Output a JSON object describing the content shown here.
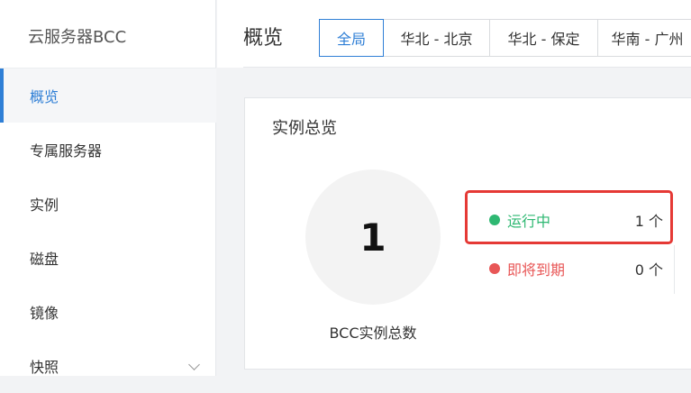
{
  "sidebar": {
    "title": "云服务器BCC",
    "items": [
      {
        "label": "概览",
        "active": true
      },
      {
        "label": "专属服务器"
      },
      {
        "label": "实例"
      },
      {
        "label": "磁盘"
      },
      {
        "label": "镜像"
      },
      {
        "label": "快照",
        "has_chevron": true
      }
    ]
  },
  "header": {
    "title": "概览",
    "region_tabs": [
      {
        "label": "全局",
        "active": true
      },
      {
        "label": "华北 - 北京"
      },
      {
        "label": "华北 - 保定"
      },
      {
        "label": "华南 - 广州"
      }
    ]
  },
  "overview_card": {
    "title": "实例总览",
    "total_count": "1",
    "total_label": "BCC实例总数",
    "statuses": [
      {
        "label": "运行中",
        "count": "1 个",
        "color": "#2eb872"
      },
      {
        "label": "即将到期",
        "count": "0 个",
        "color": "#e85656"
      }
    ]
  },
  "colors": {
    "accent": "#2f7fd6",
    "highlight": "#e53935"
  }
}
